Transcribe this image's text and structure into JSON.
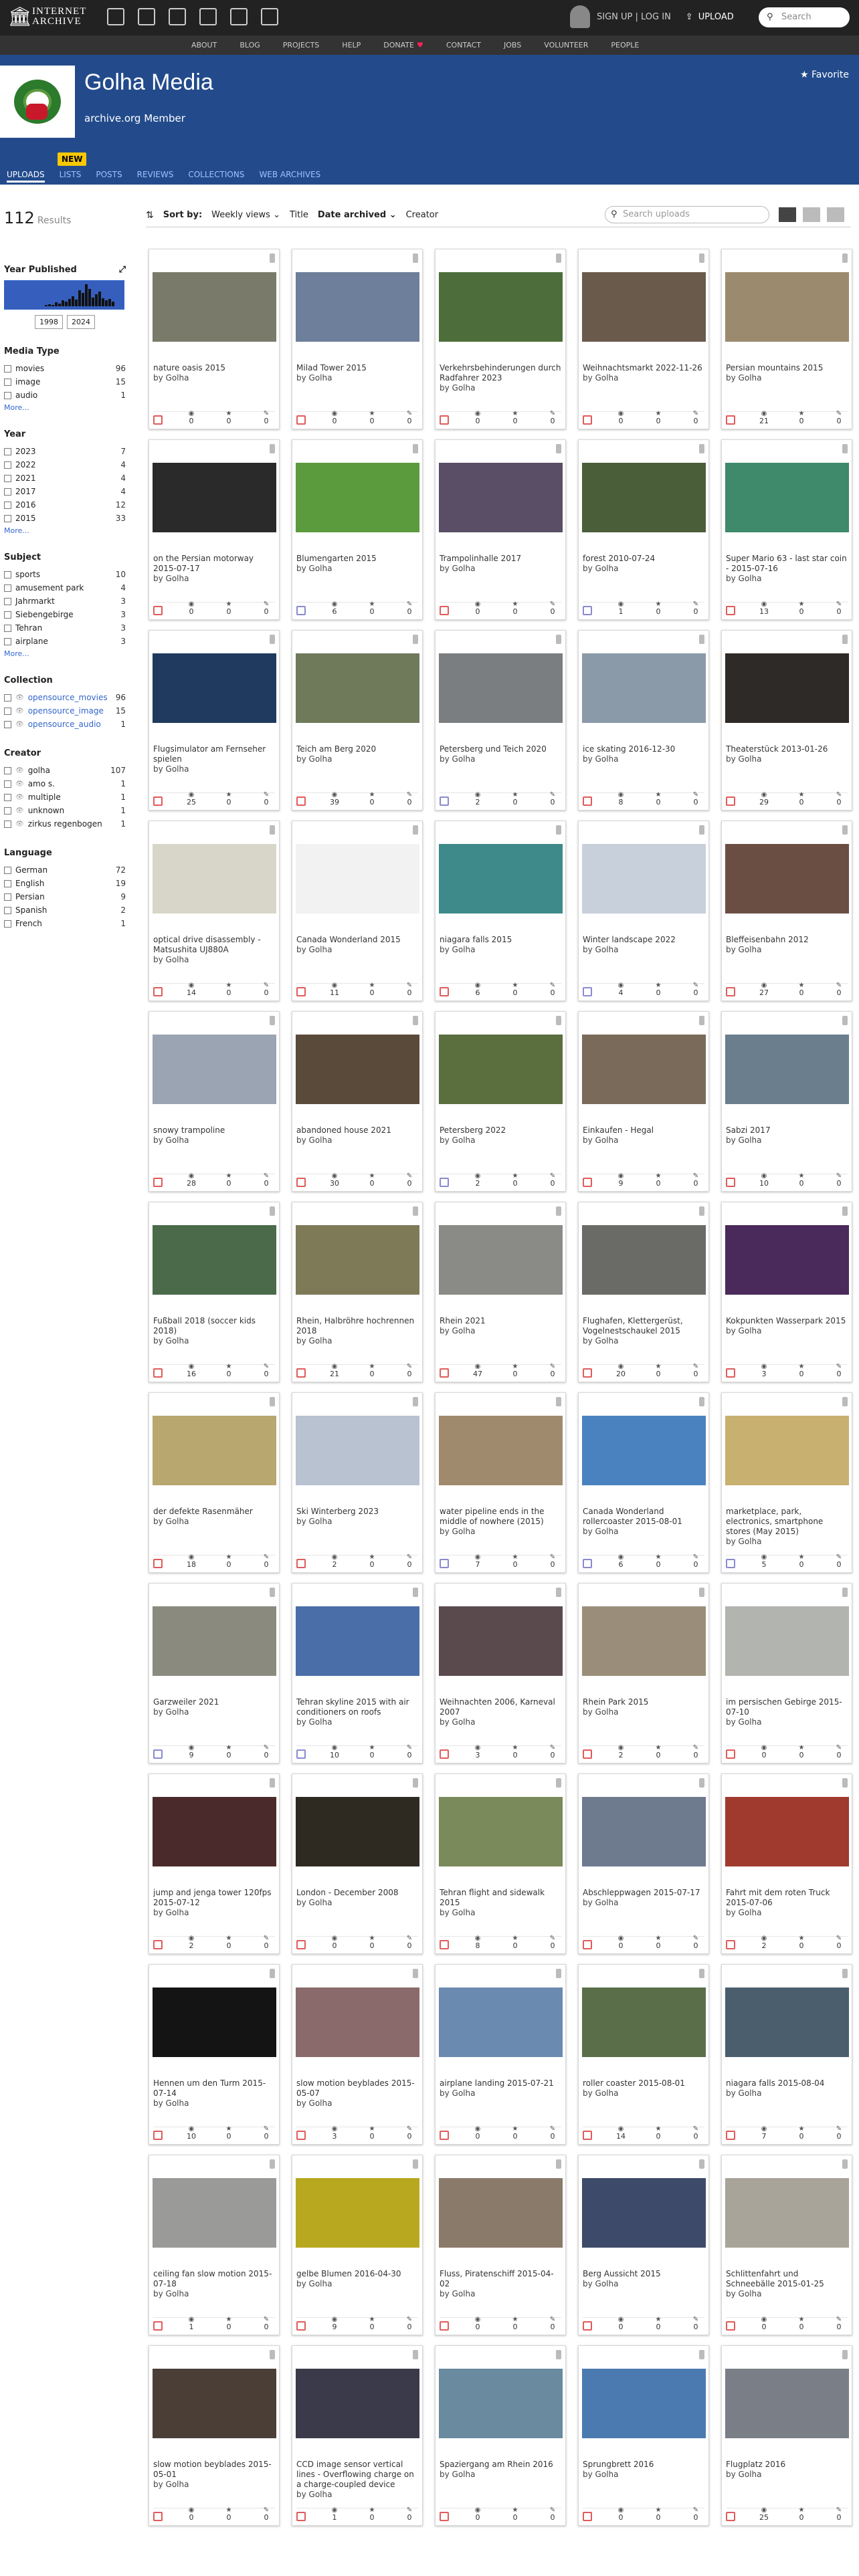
{
  "topbar": {
    "logo_line1": "INTERNET",
    "logo_line2": "ARCHIVE",
    "signup": "SIGN UP | LOG IN",
    "upload": "UPLOAD",
    "search_placeholder": "Search"
  },
  "subnav": [
    "ABOUT",
    "BLOG",
    "PROJECTS",
    "HELP",
    "DONATE",
    "CONTACT",
    "JOBS",
    "VOLUNTEER",
    "PEOPLE"
  ],
  "banner": {
    "title": "Golha Media",
    "member": "archive.org Member",
    "favorite": "Favorite",
    "new_badge": "NEW",
    "tabs": [
      "UPLOADS",
      "LISTS",
      "POSTS",
      "REVIEWS",
      "COLLECTIONS",
      "WEB ARCHIVES"
    ]
  },
  "results": {
    "count": "112",
    "label": "Results"
  },
  "sortbar": {
    "sort_by": "Sort by:",
    "weekly": "Weekly views",
    "title": "Title",
    "date": "Date archived",
    "creator": "Creator",
    "search_placeholder": "Search uploads"
  },
  "sidebar": {
    "year_published": "Year Published",
    "year_from": "1998",
    "year_to": "2024",
    "more": "More...",
    "media_type": {
      "heading": "Media Type",
      "items": [
        [
          "movies",
          "96"
        ],
        [
          "image",
          "15"
        ],
        [
          "audio",
          "1"
        ]
      ]
    },
    "year": {
      "heading": "Year",
      "items": [
        [
          "2023",
          "7"
        ],
        [
          "2022",
          "4"
        ],
        [
          "2021",
          "4"
        ],
        [
          "2017",
          "4"
        ],
        [
          "2016",
          "12"
        ],
        [
          "2015",
          "33"
        ]
      ]
    },
    "subject": {
      "heading": "Subject",
      "items": [
        [
          "sports",
          "10"
        ],
        [
          "amusement park",
          "4"
        ],
        [
          "Jahrmarkt",
          "3"
        ],
        [
          "Siebengebirge",
          "3"
        ],
        [
          "Tehran",
          "3"
        ],
        [
          "airplane",
          "3"
        ]
      ]
    },
    "collection": {
      "heading": "Collection",
      "items": [
        [
          "opensource_movies",
          "96"
        ],
        [
          "opensource_image",
          "15"
        ],
        [
          "opensource_audio",
          "1"
        ]
      ]
    },
    "creator": {
      "heading": "Creator",
      "items": [
        [
          "golha",
          "107"
        ],
        [
          "amo s.",
          "1"
        ],
        [
          "multiple",
          "1"
        ],
        [
          "unknown",
          "1"
        ],
        [
          "zirkus regenbogen",
          "1"
        ]
      ]
    },
    "language": {
      "heading": "Language",
      "items": [
        [
          "German",
          "72"
        ],
        [
          "English",
          "19"
        ],
        [
          "Persian",
          "9"
        ],
        [
          "Spanish",
          "2"
        ],
        [
          "French",
          "1"
        ]
      ]
    }
  },
  "colors": {
    "banner": "#234b8c",
    "topbar": "#222222",
    "link": "#3366cc",
    "movie_icon": "#e15b5b",
    "image_icon": "#8a8ad0"
  },
  "items": [
    {
      "title": "nature oasis 2015",
      "by": "by Golha",
      "type": "movies",
      "views": "0",
      "favs": "0",
      "reviews": "0",
      "thumb": "#7a7a6a"
    },
    {
      "title": "Milad Tower 2015",
      "by": "by Golha",
      "type": "movies",
      "views": "0",
      "favs": "0",
      "reviews": "0",
      "thumb": "#6d7f9a"
    },
    {
      "title": "Verkehrsbehinderungen durch Radfahrer 2023",
      "by": "by Golha",
      "type": "movies",
      "views": "0",
      "favs": "0",
      "reviews": "0",
      "thumb": "#4d6e3a"
    },
    {
      "title": "Weihnachtsmarkt 2022-11-26",
      "by": "by Golha",
      "type": "movies",
      "views": "0",
      "favs": "0",
      "reviews": "0",
      "thumb": "#6a5a4c"
    },
    {
      "title": "Persian mountains 2015",
      "by": "by Golha",
      "type": "movies",
      "views": "21",
      "favs": "0",
      "reviews": "0",
      "thumb": "#9c8a6e"
    },
    {
      "title": "on the Persian motorway 2015-07-17",
      "by": "by Golha",
      "type": "movies",
      "views": "0",
      "favs": "0",
      "reviews": "0",
      "thumb": "#2a2a2a"
    },
    {
      "title": "Blumengarten 2015",
      "by": "by Golha",
      "type": "image",
      "views": "6",
      "favs": "0",
      "reviews": "0",
      "thumb": "#5c9a3e"
    },
    {
      "title": "Trampolinhalle 2017",
      "by": "by Golha",
      "type": "movies",
      "views": "0",
      "favs": "0",
      "reviews": "0",
      "thumb": "#5a4e66"
    },
    {
      "title": "forest 2010-07-24",
      "by": "by Golha",
      "type": "image",
      "views": "1",
      "favs": "0",
      "reviews": "0",
      "thumb": "#4a5e3a"
    },
    {
      "title": "Super Mario 63 - last star coin - 2015-07-16",
      "by": "by Golha",
      "type": "movies",
      "views": "13",
      "favs": "0",
      "reviews": "0",
      "thumb": "#3e8a6a"
    },
    {
      "title": "Flugsimulator am Fernseher spielen",
      "by": "by Golha",
      "type": "movies",
      "views": "25",
      "favs": "0",
      "reviews": "0",
      "thumb": "#1f3a5e"
    },
    {
      "title": "Teich am Berg 2020",
      "by": "by Golha",
      "type": "movies",
      "views": "39",
      "favs": "0",
      "reviews": "0",
      "thumb": "#6e7a5a"
    },
    {
      "title": "Petersberg und Teich 2020",
      "by": "by Golha",
      "type": "image",
      "views": "2",
      "favs": "0",
      "reviews": "0",
      "thumb": "#7a7e80"
    },
    {
      "title": "ice skating 2016-12-30",
      "by": "by Golha",
      "type": "movies",
      "views": "8",
      "favs": "0",
      "reviews": "0",
      "thumb": "#8a9aa8"
    },
    {
      "title": "Theaterstück 2013-01-26",
      "by": "by Golha",
      "type": "movies",
      "views": "29",
      "favs": "0",
      "reviews": "0",
      "thumb": "#2e2a28"
    },
    {
      "title": "optical drive disassembly - Matsushita UJ880A",
      "by": "by Golha",
      "type": "movies",
      "views": "14",
      "favs": "0",
      "reviews": "0",
      "thumb": "#d8d6c8"
    },
    {
      "title": "Canada Wonderland 2015",
      "by": "by Golha",
      "type": "movies",
      "views": "11",
      "favs": "0",
      "reviews": "0",
      "thumb": "#f2f2f2"
    },
    {
      "title": "niagara falls 2015",
      "by": "by Golha",
      "type": "movies",
      "views": "6",
      "favs": "0",
      "reviews": "0",
      "thumb": "#3e8a8a"
    },
    {
      "title": "Winter landscape 2022",
      "by": "by Golha",
      "type": "image",
      "views": "4",
      "favs": "0",
      "reviews": "0",
      "thumb": "#c8d0dc"
    },
    {
      "title": "Bleffeisenbahn 2012",
      "by": "by Golha",
      "type": "movies",
      "views": "27",
      "favs": "0",
      "reviews": "0",
      "thumb": "#6a4e44"
    },
    {
      "title": "snowy trampoline",
      "by": "by Golha",
      "type": "movies",
      "views": "28",
      "favs": "0",
      "reviews": "0",
      "thumb": "#9aa4b2"
    },
    {
      "title": "abandoned house 2021",
      "by": "by Golha",
      "type": "movies",
      "views": "30",
      "favs": "0",
      "reviews": "0",
      "thumb": "#5a4a3a"
    },
    {
      "title": "Petersberg 2022",
      "by": "by Golha",
      "type": "image",
      "views": "2",
      "favs": "0",
      "reviews": "0",
      "thumb": "#5a6e3e"
    },
    {
      "title": "Einkaufen - Hegal",
      "by": "by Golha",
      "type": "movies",
      "views": "9",
      "favs": "0",
      "reviews": "0",
      "thumb": "#7a6a5a"
    },
    {
      "title": "Sabzi 2017",
      "by": "by Golha",
      "type": "movies",
      "views": "10",
      "favs": "0",
      "reviews": "0",
      "thumb": "#6a7e8e"
    },
    {
      "title": "Fußball 2018 (soccer kids 2018)",
      "by": "by Golha",
      "type": "movies",
      "views": "16",
      "favs": "0",
      "reviews": "0",
      "thumb": "#4a6a4a"
    },
    {
      "title": "Rhein, Halbröhre hochrennen 2018",
      "by": "by Golha",
      "type": "movies",
      "views": "21",
      "favs": "0",
      "reviews": "0",
      "thumb": "#7e7a58"
    },
    {
      "title": "Rhein 2021",
      "by": "by Golha",
      "type": "movies",
      "views": "47",
      "favs": "0",
      "reviews": "0",
      "thumb": "#8a8a86"
    },
    {
      "title": "Flughafen, Klettergerüst, Vogelnestschaukel 2015",
      "by": "by Golha",
      "type": "movies",
      "views": "20",
      "favs": "0",
      "reviews": "0",
      "thumb": "#6a6a66"
    },
    {
      "title": "Kokpunkten Wasserpark 2015",
      "by": "by Golha",
      "type": "movies",
      "views": "3",
      "favs": "0",
      "reviews": "0",
      "thumb": "#4a2a5a"
    },
    {
      "title": "der defekte Rasenmäher",
      "by": "by Golha",
      "type": "movies",
      "views": "18",
      "favs": "0",
      "reviews": "0",
      "thumb": "#b8a870"
    },
    {
      "title": "Ski Winterberg 2023",
      "by": "by Golha",
      "type": "movies",
      "views": "2",
      "favs": "0",
      "reviews": "0",
      "thumb": "#b8c2d0"
    },
    {
      "title": "water pipeline ends in the middle of nowhere (2015)",
      "by": "by Golha",
      "type": "image",
      "views": "7",
      "favs": "0",
      "reviews": "0",
      "thumb": "#a08a6e"
    },
    {
      "title": "Canada Wonderland rollercoaster 2015-08-01",
      "by": "by Golha",
      "type": "image",
      "views": "6",
      "favs": "0",
      "reviews": "0",
      "thumb": "#4a82c0"
    },
    {
      "title": "marketplace, park, electronics, smartphone stores (May 2015)",
      "by": "by Golha",
      "type": "image",
      "views": "5",
      "favs": "0",
      "reviews": "0",
      "thumb": "#c8b070"
    },
    {
      "title": "Garzweiler 2021",
      "by": "by Golha",
      "type": "image",
      "views": "9",
      "favs": "0",
      "reviews": "0",
      "thumb": "#8a8a7e"
    },
    {
      "title": "Tehran skyline 2015 with air conditioners on roofs",
      "by": "by Golha",
      "type": "image",
      "views": "10",
      "favs": "0",
      "reviews": "0",
      "thumb": "#4a6ea8"
    },
    {
      "title": "Weihnachten 2006, Karneval 2007",
      "by": "by Golha",
      "type": "movies",
      "views": "3",
      "favs": "0",
      "reviews": "0",
      "thumb": "#5a4a4e"
    },
    {
      "title": "Rhein Park 2015",
      "by": "by Golha",
      "type": "movies",
      "views": "2",
      "favs": "0",
      "reviews": "0",
      "thumb": "#9a8e7a"
    },
    {
      "title": "im persischen Gebirge 2015-07-10",
      "by": "by Golha",
      "type": "movies",
      "views": "0",
      "favs": "0",
      "reviews": "0",
      "thumb": "#b2b4b0"
    },
    {
      "title": "jump and jenga tower 120fps 2015-07-12",
      "by": "by Golha",
      "type": "movies",
      "views": "2",
      "favs": "0",
      "reviews": "0",
      "thumb": "#4a2a2a"
    },
    {
      "title": "London - December 2008",
      "by": "by Golha",
      "type": "movies",
      "views": "0",
      "favs": "0",
      "reviews": "0",
      "thumb": "#2e2a22"
    },
    {
      "title": "Tehran flight and sidewalk 2015",
      "by": "by Golha",
      "type": "movies",
      "views": "8",
      "favs": "0",
      "reviews": "0",
      "thumb": "#7a8a5a"
    },
    {
      "title": "Abschleppwagen 2015-07-17",
      "by": "by Golha",
      "type": "movies",
      "views": "0",
      "favs": "0",
      "reviews": "0",
      "thumb": "#6e7a8e"
    },
    {
      "title": "Fahrt mit dem roten Truck 2015-07-06",
      "by": "by Golha",
      "type": "movies",
      "views": "2",
      "favs": "0",
      "reviews": "0",
      "thumb": "#a03a2e"
    },
    {
      "title": "Hennen um den Turm 2015-07-14",
      "by": "by Golha",
      "type": "movies",
      "views": "10",
      "favs": "0",
      "reviews": "0",
      "thumb": "#141414"
    },
    {
      "title": "slow motion beyblades 2015-05-07",
      "by": "by Golha",
      "type": "movies",
      "views": "3",
      "favs": "0",
      "reviews": "0",
      "thumb": "#8a6a6a"
    },
    {
      "title": "airplane landing 2015-07-21",
      "by": "by Golha",
      "type": "movies",
      "views": "0",
      "favs": "0",
      "reviews": "0",
      "thumb": "#6a8ab0"
    },
    {
      "title": "roller coaster 2015-08-01",
      "by": "by Golha",
      "type": "movies",
      "views": "14",
      "favs": "0",
      "reviews": "0",
      "thumb": "#5a6e4a"
    },
    {
      "title": "niagara falls 2015-08-04",
      "by": "by Golha",
      "type": "movies",
      "views": "7",
      "favs": "0",
      "reviews": "0",
      "thumb": "#4a5e6e"
    },
    {
      "title": "ceiling fan slow motion 2015-07-18",
      "by": "by Golha",
      "type": "movies",
      "views": "1",
      "favs": "0",
      "reviews": "0",
      "thumb": "#9a9a98"
    },
    {
      "title": "gelbe Blumen 2016-04-30",
      "by": "by Golha",
      "type": "movies",
      "views": "9",
      "favs": "0",
      "reviews": "0",
      "thumb": "#b8a820"
    },
    {
      "title": "Fluss, Piratenschiff 2015-04-02",
      "by": "by Golha",
      "type": "movies",
      "views": "0",
      "favs": "0",
      "reviews": "0",
      "thumb": "#8a7a6a"
    },
    {
      "title": "Berg Aussicht 2015",
      "by": "by Golha",
      "type": "movies",
      "views": "0",
      "favs": "0",
      "reviews": "0",
      "thumb": "#3e4a6a"
    },
    {
      "title": "Schlittenfahrt und Schneebälle 2015-01-25",
      "by": "by Golha",
      "type": "movies",
      "views": "0",
      "favs": "0",
      "reviews": "0",
      "thumb": "#a8a49a"
    },
    {
      "title": "slow motion beyblades 2015-05-01",
      "by": "by Golha",
      "type": "movies",
      "views": "0",
      "favs": "0",
      "reviews": "0",
      "thumb": "#4a3e36"
    },
    {
      "title": "CCD image sensor vertical lines - Overflowing charge on a charge-coupled device",
      "by": "by Golha",
      "type": "movies",
      "views": "1",
      "favs": "0",
      "reviews": "0",
      "thumb": "#3a3a4a"
    },
    {
      "title": "Spaziergang am Rhein 2016",
      "by": "by Golha",
      "type": "movies",
      "views": "0",
      "favs": "0",
      "reviews": "0",
      "thumb": "#6a8aa0"
    },
    {
      "title": "Sprungbrett 2016",
      "by": "by Golha",
      "type": "movies",
      "views": "0",
      "favs": "0",
      "reviews": "0",
      "thumb": "#4a7ab0"
    },
    {
      "title": "Flugplatz 2016",
      "by": "by Golha",
      "type": "movies",
      "views": "25",
      "favs": "0",
      "reviews": "0",
      "thumb": "#7a7e86"
    }
  ]
}
